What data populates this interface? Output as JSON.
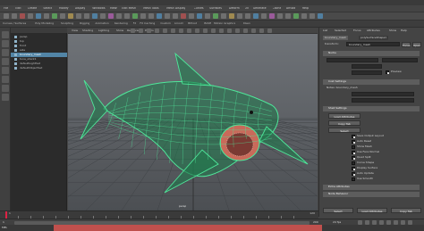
{
  "menubar": {
    "items": [
      "File",
      "Edit",
      "Create",
      "Select",
      "Modify",
      "Display",
      "Windows",
      "Mesh",
      "Edit Mesh",
      "Mesh Tools",
      "Mesh Display",
      "Curves",
      "Surfaces",
      "Deform",
      "UV",
      "Generate",
      "Cache",
      "Arnold",
      "Help"
    ]
  },
  "shelf_tabs": [
    "Curves / Surfaces",
    "Poly Modeling",
    "Sculpting",
    "Rigging",
    "Animation",
    "Rendering",
    "FX",
    "FX Caching",
    "Custom",
    "Arnold",
    "Bifrost",
    "MASH",
    "Motion Graphics",
    "XGen"
  ],
  "outliner": {
    "rows": [
      {
        "label": "persp",
        "selected": false
      },
      {
        "label": "top",
        "selected": false
      },
      {
        "label": "front",
        "selected": false
      },
      {
        "label": "side",
        "selected": false
      },
      {
        "label": "boundary_mesh",
        "selected": true
      },
      {
        "label": "tuna_shark1",
        "selected": false
      },
      {
        "label": "defaultLightSet",
        "selected": false
      },
      {
        "label": "defaultObjectSet",
        "selected": false
      }
    ]
  },
  "viewport": {
    "menus": [
      "View",
      "Shading",
      "Lighting",
      "Show",
      "Renderer",
      "Panels"
    ],
    "camera": "persp",
    "colors": {
      "wire": "#4ee89a",
      "wire_dark": "#1f7a4c",
      "mouth": "#c96a5a"
    }
  },
  "attribute_editor": {
    "tabs": [
      "List",
      "Selected",
      "Focus",
      "Attributes",
      "Show",
      "Help"
    ],
    "node_tabs": [
      "boundary_mesh",
      "polySurfaceShape1"
    ],
    "transform_label": "transform:",
    "node_name": "boundary_mesh",
    "sections": {
      "nurbs": "Nurbs",
      "cost_settings": "Cost Settings",
      "shell": "Shell Settings",
      "extra": "Extra Attributes",
      "node_behavior": "Node Behavior"
    },
    "buttons": {
      "open": "Open",
      "focus": "Focus",
      "select": "Select",
      "load_attributes": "Load Attributes",
      "copy_tab": "Copy Tab"
    },
    "check_labels": [
      "Preview",
      "Save Output Layout",
      "Auto Reset",
      "Show Mesh",
      "Use Face Normal",
      "Quad Split",
      "Curve Shape",
      "Display Surface",
      "Auto Update",
      "Use Smooth"
    ],
    "fields": {
      "notes_label": "Notes: boundary_mesh"
    }
  },
  "timeline": {
    "start": "1",
    "end": "120",
    "current": "1"
  },
  "range": {
    "min": "1",
    "max": "200",
    "fps": "24 fps"
  },
  "command": {
    "label": "MEL",
    "error": ""
  }
}
